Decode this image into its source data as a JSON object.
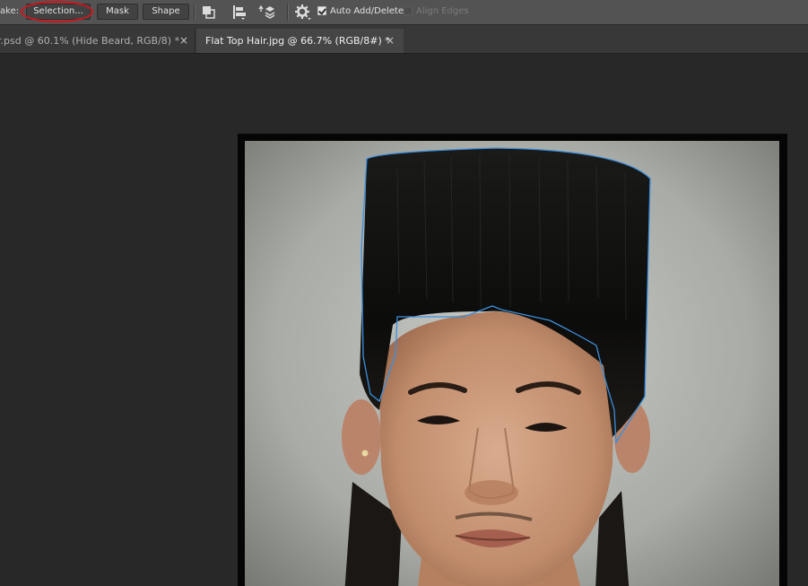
{
  "options_bar": {
    "make_label": "ake:",
    "selection_button": "Selection...",
    "mask_button": "Mask",
    "shape_button": "Shape",
    "auto_add_delete": {
      "label": "Auto Add/Delete",
      "checked": true
    },
    "align_edges": {
      "label": "Align Edges",
      "checked": false,
      "enabled": false
    },
    "highlight_color": "#d4141c"
  },
  "tabs": [
    {
      "title": "r.psd @ 60.1% (Hide Beard, RGB/8) *",
      "close": "×",
      "active": false
    },
    {
      "title": "Flat Top Hair.jpg @ 66.7% (RGB/8#) *",
      "close": "×",
      "active": true
    }
  ],
  "canvas": {
    "path_color": "#3c8fdc",
    "background_color": "#282828"
  }
}
